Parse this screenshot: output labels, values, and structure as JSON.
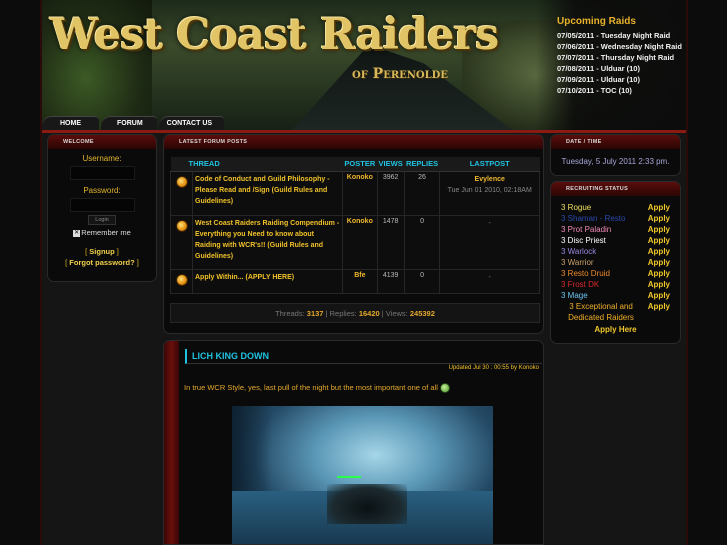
{
  "header": {
    "logo_title": "West Coast Raiders",
    "logo_subtitle": "of Perenolde",
    "upcoming": {
      "title": "Upcoming Raids",
      "items": [
        "07/05/2011 - Tuesday Night Raid",
        "07/06/2011 - Wednesday Night Raid",
        "07/07/2011 - Thursday Night Raid",
        "07/08/2011 - Ulduar (10)",
        "07/09/2011 - Ulduar (10)",
        "07/10/2011 - TOC (10)"
      ]
    }
  },
  "nav": {
    "home": "HOME",
    "forum": "FORUM",
    "contact": "CONTACT US"
  },
  "welcome": {
    "heading": "WELCOME",
    "username_label": "Username:",
    "password_label": "Password:",
    "login_button": "Login",
    "remember": "Remember me",
    "signup": "Signup",
    "forgot": "Forgot password?"
  },
  "forum": {
    "heading": "LATEST FORUM POSTS",
    "columns": {
      "thread": "THREAD",
      "poster": "POSTER",
      "views": "VIEWS",
      "replies": "REPLIES",
      "lastpost": "LASTPOST"
    },
    "rows": [
      {
        "thread": "Code of Conduct and Guild Philosophy - Please Read and /Sign (Guild Rules and Guidelines)",
        "poster": "Konoko",
        "views": "3962",
        "replies": "26",
        "last_user": "Evylence",
        "last_date": "Tue Jun 01 2010, 02:18AM"
      },
      {
        "thread": "West Coast Raiders Raiding Compendium - Everything you Need to know about Raiding with WCR's!! (Guild Rules and Guidelines)",
        "poster": "Konoko",
        "views": "1478",
        "replies": "0",
        "last_user": "-",
        "last_date": ""
      },
      {
        "thread": "Apply Within... (APPLY HERE)",
        "poster": "Bfe",
        "views": "4139",
        "replies": "0",
        "last_user": "-",
        "last_date": ""
      }
    ],
    "stats": {
      "threads_label": "Threads:",
      "threads": "3137",
      "replies_label": "| Replies:",
      "replies": "16420",
      "views_label": "| Views:",
      "views": "245392"
    }
  },
  "datetime": {
    "heading": "DATE / TIME",
    "value": "Tuesday, 5 July 2011 2:33 pm."
  },
  "recruit": {
    "heading": "RECRUITING STATUS",
    "apply": "Apply",
    "apply_here": "Apply Here",
    "items": [
      {
        "label": "3 Rogue",
        "color": "#f0e060"
      },
      {
        "label": "3 Shaman - Resto",
        "color": "#2a4ab0"
      },
      {
        "label": "3 Prot Paladin",
        "color": "#f08ab8"
      },
      {
        "label": "3 Disc Priest",
        "color": "#ffffff"
      },
      {
        "label": "3 Warlock",
        "color": "#9a86e0"
      },
      {
        "label": "3 Warrior",
        "color": "#c8a06a"
      },
      {
        "label": "3 Resto Druid",
        "color": "#f08a2a"
      },
      {
        "label": "3 Frost DK",
        "color": "#d8282a"
      },
      {
        "label": "3 Mage",
        "color": "#6ac6f0"
      },
      {
        "label": "3 Exceptional and Dedicated Raiders",
        "color": "#f0b02a"
      }
    ]
  },
  "news": {
    "title": "LICH KING DOWN",
    "meta": "Updated Jul 30 : 00:55 by Konoko",
    "body": "In true WCR Style, yes, last pull of the night but the most important one of all"
  }
}
